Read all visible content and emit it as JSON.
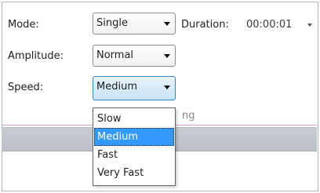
{
  "mode": {
    "label": "Mode:",
    "value": "Single"
  },
  "duration": {
    "label": "Duration:",
    "value": "00:00:01"
  },
  "amplitude": {
    "label": "Amplitude:",
    "value": "Normal"
  },
  "speed": {
    "label": "Speed:",
    "value": "Medium",
    "options": [
      "Slow",
      "Medium",
      "Fast",
      "Very Fast"
    ],
    "selected_option": "Medium"
  },
  "background_partial_text": "ng",
  "colors": {
    "highlight": "#3399ff",
    "focus_border": "#2f86c8"
  }
}
